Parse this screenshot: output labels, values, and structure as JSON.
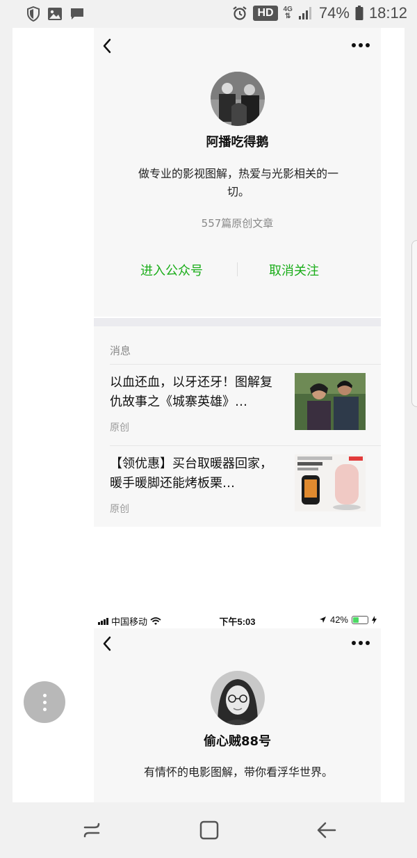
{
  "status_bar": {
    "icons": [
      "shield-icon",
      "image-icon",
      "message-icon",
      "alarm-icon",
      "signal-icon",
      "battery-icon"
    ],
    "hd": "HD",
    "network": "4G",
    "battery": "74%",
    "time": "18:12"
  },
  "profile1": {
    "name": "阿播吃得鹅",
    "desc": "做专业的影视图解，热爱与光影相关的一切。",
    "count": "557篇原创文章",
    "enter_label": "进入公众号",
    "unfollow_label": "取消关注",
    "section_label": "消息",
    "articles": [
      {
        "title": "以血还血，以牙还牙！图解复仇故事之《城寨英雄》…",
        "tag": "原创"
      },
      {
        "title": "【领优惠】买台取暖器回家，暖手暖脚还能烤板栗…",
        "tag": "原创"
      }
    ]
  },
  "ios_bar": {
    "carrier": "中国移动",
    "time": "下午5:03",
    "battery": "42%",
    "battery_level": 0.42
  },
  "profile2": {
    "name": "偷心贼88号",
    "desc": "有情怀的电影图解，带你看浮华世界。"
  },
  "colors": {
    "accent_green": "#1aad19",
    "muted_text": "#888888",
    "card_bg": "#f7f7f7"
  }
}
